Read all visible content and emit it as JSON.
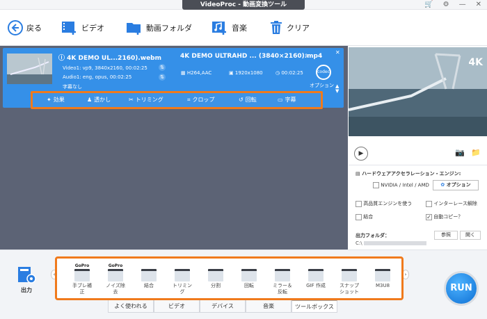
{
  "window": {
    "title": "VideoProc - 動画変換ツール"
  },
  "toolbar": {
    "back": "戻る",
    "video": "ビデオ",
    "folder": "動画フォルダ",
    "music": "音楽",
    "clear": "クリア"
  },
  "file": {
    "source_name": "4K DEMO UL...2160).webm",
    "video_info": "Video1: vp9, 3840x2160, 00:02:25",
    "audio_info": "Audio1: eng, opus, 00:02:25",
    "subtitle": "字幕なし",
    "output_name": "4K DEMO ULTRAHD ... (3840×2160).mp4",
    "codec": "H264,AAC",
    "resolution": "1920x1080",
    "duration": "00:02:25",
    "codec_badge": "codec",
    "option": "オプション"
  },
  "edit": {
    "effect": "効果",
    "watermark": "透かし",
    "trim": "トリミング",
    "crop": "クロップ",
    "rotate": "回転",
    "subtitle": "字幕"
  },
  "preview": {
    "badge": "4K"
  },
  "hw": {
    "title": "ハードウェアアクセラレーション・エンジン:",
    "gpu": "NVIDIA / Intel / AMD",
    "option_btn": "オプション",
    "hq": "高品質エンジンを使う",
    "deinterlace": "インターレース解除",
    "merge": "結合",
    "autocopy": "自動コピー？"
  },
  "output": {
    "label": "出力フォルダ：",
    "path": "C:\\",
    "browse": "参照",
    "open": "開く"
  },
  "bottom": {
    "output_label": "出力",
    "tools": [
      {
        "label": "手ブレ補\n正",
        "brand": "GoPro"
      },
      {
        "label": "ノイズ除\n去",
        "brand": "GoPro"
      },
      {
        "label": "結合",
        "brand": ""
      },
      {
        "label": "トリミン\nグ",
        "brand": ""
      },
      {
        "label": "分割",
        "brand": ""
      },
      {
        "label": "回転",
        "brand": ""
      },
      {
        "label": "ミラー＆\n反転",
        "brand": ""
      },
      {
        "label": "GIF 作成",
        "brand": ""
      },
      {
        "label": "スナップ\nショット",
        "brand": ""
      },
      {
        "label": "M3U8",
        "brand": ""
      }
    ],
    "tabs": [
      "よく使われる",
      "ビデオ",
      "デバイス",
      "音楽",
      "ツールボックス"
    ],
    "run": "RUN"
  },
  "colors": {
    "accent": "#3590e8",
    "highlight": "#f07a1c"
  }
}
